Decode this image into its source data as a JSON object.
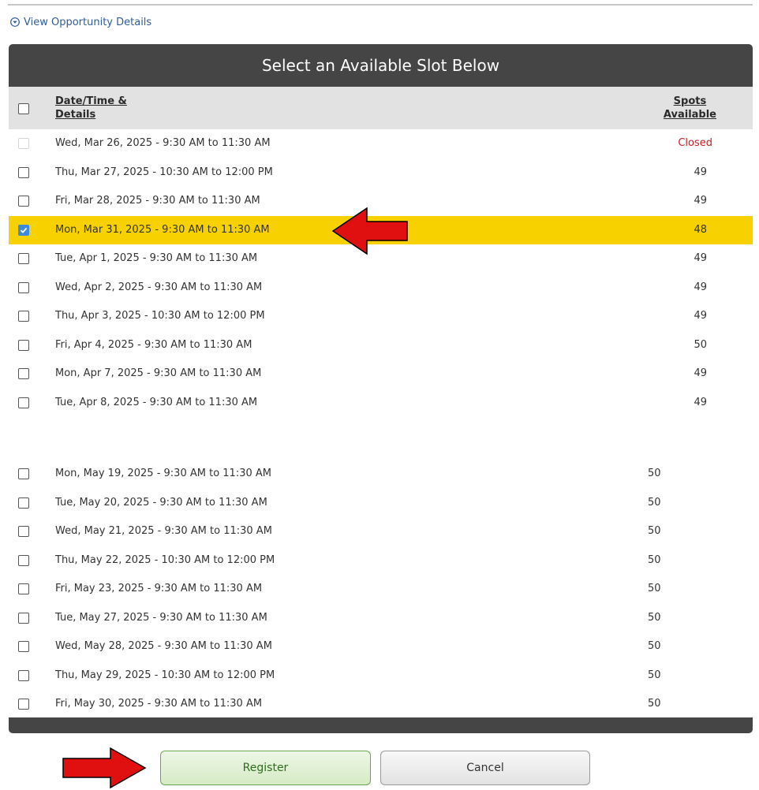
{
  "details_link": {
    "label": "View Opportunity Details",
    "icon": "circle-chevron-down-icon"
  },
  "panel": {
    "title": "Select an Available Slot Below",
    "header": {
      "date_label_line1": "Date/Time &",
      "date_label_line2": "Details",
      "spots_label_line1": "Spots",
      "spots_label_line2": "Available"
    },
    "rows_group1": [
      {
        "slot": "Wed, Mar 26, 2025 - 9:30 AM to 11:30 AM",
        "spots": "Closed",
        "state": "disabled"
      },
      {
        "slot": "Thu, Mar 27, 2025 - 10:30 AM to 12:00 PM",
        "spots": "49",
        "state": "unchecked"
      },
      {
        "slot": "Fri, Mar 28, 2025 - 9:30 AM to 11:30 AM",
        "spots": "49",
        "state": "unchecked"
      },
      {
        "slot": "Mon, Mar 31, 2025 - 9:30 AM to 11:30 AM",
        "spots": "48",
        "state": "checked"
      },
      {
        "slot": "Tue, Apr 1, 2025 - 9:30 AM to 11:30 AM",
        "spots": "49",
        "state": "unchecked"
      },
      {
        "slot": "Wed, Apr 2, 2025 - 9:30 AM to 11:30 AM",
        "spots": "49",
        "state": "unchecked"
      },
      {
        "slot": "Thu, Apr 3, 2025 - 10:30 AM to 12:00 PM",
        "spots": "49",
        "state": "unchecked"
      },
      {
        "slot": "Fri, Apr 4, 2025 - 9:30 AM to 11:30 AM",
        "spots": "50",
        "state": "unchecked"
      },
      {
        "slot": "Mon, Apr 7, 2025 - 9:30 AM to 11:30 AM",
        "spots": "49",
        "state": "unchecked"
      },
      {
        "slot": "Tue, Apr 8, 2025 - 9:30 AM to 11:30 AM",
        "spots": "49",
        "state": "unchecked"
      }
    ],
    "rows_group2": [
      {
        "slot": "Mon, May 19, 2025 - 9:30 AM to 11:30 AM",
        "spots": "50",
        "state": "unchecked"
      },
      {
        "slot": "Tue, May 20, 2025 - 9:30 AM to 11:30 AM",
        "spots": "50",
        "state": "unchecked"
      },
      {
        "slot": "Wed, May 21, 2025 - 9:30 AM to 11:30 AM",
        "spots": "50",
        "state": "unchecked"
      },
      {
        "slot": "Thu, May 22, 2025 - 10:30 AM to 12:00 PM",
        "spots": "50",
        "state": "unchecked"
      },
      {
        "slot": "Fri, May 23, 2025 - 9:30 AM to 11:30 AM",
        "spots": "50",
        "state": "unchecked"
      },
      {
        "slot": "Tue, May 27, 2025 - 9:30 AM to 11:30 AM",
        "spots": "50",
        "state": "unchecked"
      },
      {
        "slot": "Wed, May 28, 2025 - 9:30 AM to 11:30 AM",
        "spots": "50",
        "state": "unchecked"
      },
      {
        "slot": "Thu, May 29, 2025 - 10:30 AM to 12:00 PM",
        "spots": "50",
        "state": "unchecked"
      },
      {
        "slot": "Fri, May 30, 2025 - 9:30 AM to 11:30 AM",
        "spots": "50",
        "state": "unchecked"
      }
    ]
  },
  "buttons": {
    "register": "Register",
    "cancel": "Cancel"
  },
  "colors": {
    "header_bg": "#454545",
    "selected_row": "#f8d100",
    "closed_text": "#c81e1e",
    "checkbox_checked": "#3a8be0",
    "arrow": "#e01010"
  }
}
